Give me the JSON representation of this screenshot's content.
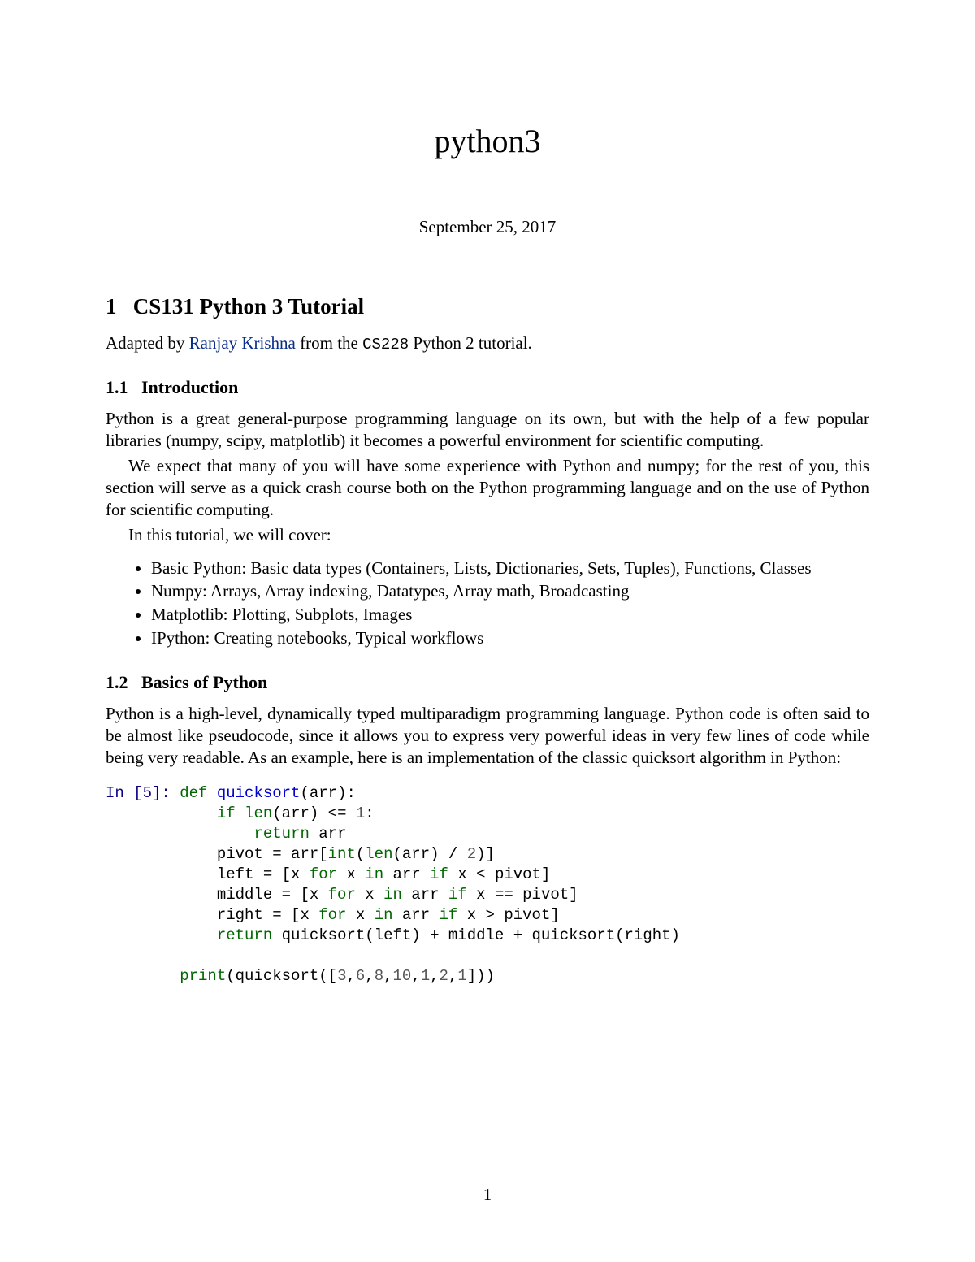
{
  "title": "python3",
  "date": "September 25, 2017",
  "section1": {
    "num": "1",
    "heading": "CS131 Python 3 Tutorial",
    "adapted_pre": "Adapted by ",
    "adapted_link": "Ranjay Krishna",
    "adapted_mid": " from the ",
    "adapted_code": "CS228",
    "adapted_post": " Python 2 tutorial."
  },
  "section1_1": {
    "num": "1.1",
    "heading": "Introduction",
    "p1": "Python is a great general-purpose programming language on its own, but with the help of a few popular libraries (numpy, scipy, matplotlib) it becomes a powerful environment for scientific computing.",
    "p2": "We expect that many of you will have some experience with Python and numpy; for the rest of you, this section will serve as a quick crash course both on the Python programming language and on the use of Python for scientific computing.",
    "p3": "In this tutorial, we will cover:",
    "bullets": [
      "Basic Python: Basic data types (Containers, Lists, Dictionaries, Sets, Tuples), Functions, Classes",
      "Numpy: Arrays, Array indexing, Datatypes, Array math, Broadcasting",
      "Matplotlib: Plotting, Subplots, Images",
      "IPython: Creating notebooks, Typical workflows"
    ]
  },
  "section1_2": {
    "num": "1.2",
    "heading": "Basics of Python",
    "p1": "Python is a high-level, dynamically typed multiparadigm programming language. Python code is often said to be almost like pseudocode, since it allows you to express very powerful ideas in very few lines of code while being very readable. As an example, here is an implementation of the classic quicksort algorithm in Python:"
  },
  "code": {
    "prompt": "In [5]: ",
    "tokens": {
      "def": "def",
      "if": "if",
      "return": "return",
      "for": "for",
      "in": "in",
      "len": "len",
      "int": "int",
      "print": "print",
      "quicksort": "quicksort"
    },
    "l1a": "(arr):",
    "l2a": "(arr) <= ",
    "l2b": "1",
    "l2c": ":",
    "l3": " arr",
    "l4a": "pivot = arr[",
    "l4b": "(",
    "l4c": "(arr) / ",
    "l4d": "2",
    "l4e": ")]",
    "l5a": "left = [x ",
    "l5b": " x ",
    "l5c": " arr ",
    "l5d": " x < pivot]",
    "l6a": "middle = [x ",
    "l6d": " x == pivot]",
    "l7a": "right = [x ",
    "l7d": " x > pivot]",
    "l8": " quicksort(left) + middle + quicksort(right)",
    "l10a": "(quicksort([",
    "l10b": "3",
    "l10c": ",",
    "l10d": "6",
    "l10e": "8",
    "l10f": "10",
    "l10g": "1",
    "l10h": "2",
    "l10i": "1",
    "l10j": "]))"
  },
  "pagenum": "1"
}
